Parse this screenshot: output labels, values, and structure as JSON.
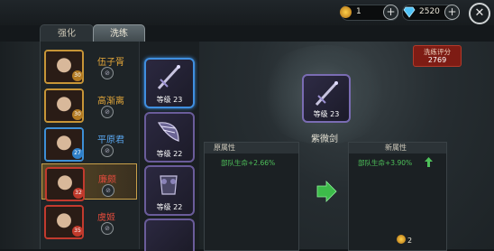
{
  "topbar": {
    "gold_amount": "1",
    "diamond_amount": "2520",
    "close_icon": "close-icon"
  },
  "tabs": [
    {
      "label": "强化"
    },
    {
      "label": "洗练"
    }
  ],
  "heroes": [
    {
      "name": "伍子胥",
      "level": "30",
      "color": "orange"
    },
    {
      "name": "高渐离",
      "level": "30",
      "color": "orange"
    },
    {
      "name": "平原君",
      "level": "27",
      "color": "blue"
    },
    {
      "name": "廉颇",
      "level": "32",
      "color": "red"
    },
    {
      "name": "虞姬",
      "level": "35",
      "color": "red"
    }
  ],
  "items": [
    {
      "level_label": "等级 23",
      "icon": "sword-icon"
    },
    {
      "level_label": "等级 22",
      "icon": "blade-icon"
    },
    {
      "level_label": "等级 22",
      "icon": "armor-icon"
    }
  ],
  "refine": {
    "score_label": "洗练评分",
    "score_value": "2769",
    "weapon_name": "紫微剑",
    "weapon_level": "等级 23",
    "old_header": "原属性",
    "old_attr": "部队生命+2.66%",
    "new_header": "新属性",
    "new_attr": "部队生命+3.90%",
    "gold_count": "2"
  },
  "colors": {
    "accent_gold": "#c9a04a",
    "attr_green": "#4ec05a",
    "score_red": "#7e1c14"
  }
}
